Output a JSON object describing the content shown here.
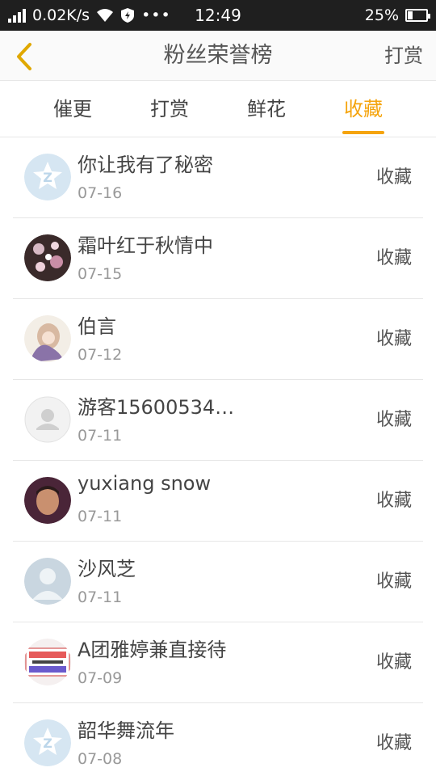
{
  "status_bar": {
    "network_speed": "0.02K/s",
    "time": "12:49",
    "battery": "25%",
    "battery_level": 0.25
  },
  "header": {
    "title": "粉丝荣誉榜",
    "action": "打赏"
  },
  "tabs": [
    {
      "label": "催更",
      "active": false
    },
    {
      "label": "打赏",
      "active": false
    },
    {
      "label": "鲜花",
      "active": false
    },
    {
      "label": "收藏",
      "active": true
    }
  ],
  "fans": [
    {
      "name": "你让我有了秘密",
      "date": "07-16",
      "action": "收藏",
      "avatar": "qq-default-icon"
    },
    {
      "name": "霜叶红于秋情中",
      "date": "07-15",
      "action": "收藏",
      "avatar": "flower-photo"
    },
    {
      "name": "伯言",
      "date": "07-12",
      "action": "收藏",
      "avatar": "anime-girl"
    },
    {
      "name": "游客15600534…",
      "date": "07-11",
      "action": "收藏",
      "avatar": "guest-user-icon"
    },
    {
      "name": "yuxiang snow",
      "date": "07-11",
      "action": "收藏",
      "avatar": "man-photo"
    },
    {
      "name": "沙风芝",
      "date": "07-11",
      "action": "收藏",
      "avatar": "default-user-icon"
    },
    {
      "name": "A团雅婷兼直接待",
      "date": "07-09",
      "action": "收藏",
      "avatar": "recruitment-sign"
    },
    {
      "name": "韶华舞流年",
      "date": "07-08",
      "action": "收藏",
      "avatar": "qq-default-icon"
    }
  ],
  "colors": {
    "accent": "#f5a40d",
    "status_bar_bg": "#1f1f1f"
  }
}
